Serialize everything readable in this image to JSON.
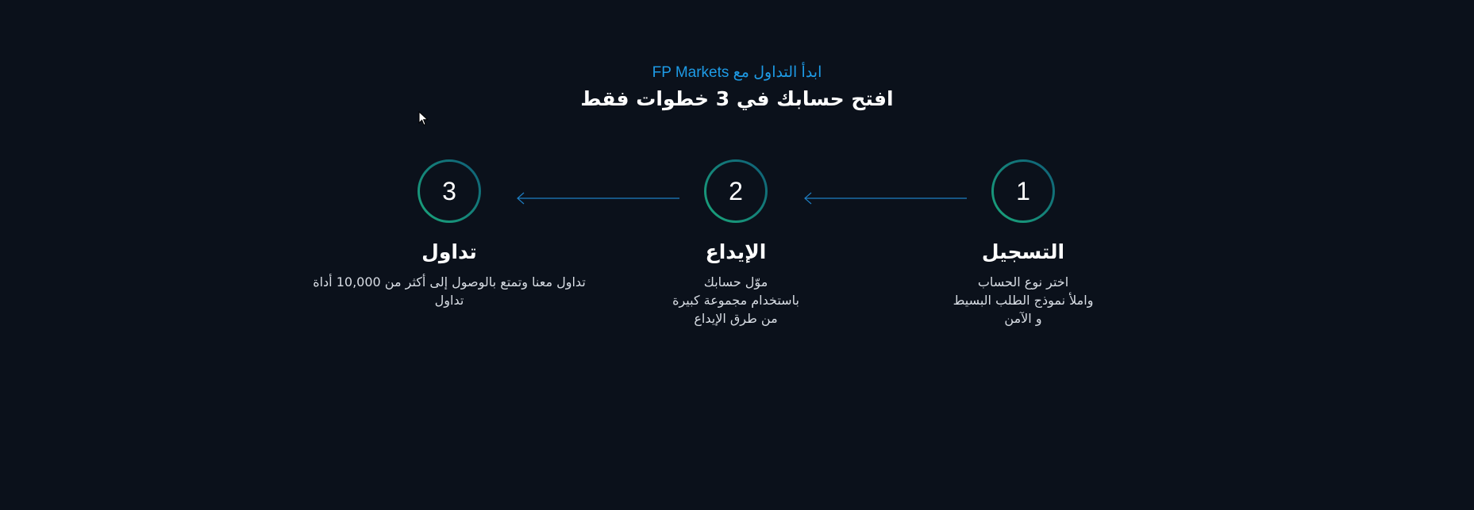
{
  "header": {
    "eyebrow": "ابدأ التداول مع FP Markets",
    "title": "افتح حسابك في 3 خطوات فقط"
  },
  "colors": {
    "background": "#0b111b",
    "accent_blue": "#1e9be6",
    "circle_gradient_start": "#1aa57a",
    "circle_gradient_end": "#0f5e78",
    "arrow": "#1e7fc4"
  },
  "steps": [
    {
      "number": "1",
      "title": "التسجيل",
      "description": "اختر نوع الحساب\nواملأ نموذج الطلب البسيط\nو الآمن"
    },
    {
      "number": "2",
      "title": "الإيداع",
      "description": "موّل حسابك\nباستخدام مجموعة كبيرة\nمن طرق الإيداع"
    },
    {
      "number": "3",
      "title": "تداول",
      "description": "تداول معنا وتمتع بالوصول إلى أكثر من 10,000 أداة\nتداول"
    }
  ],
  "icons": {
    "arrow": "arrow-left-icon",
    "cursor": "mouse-cursor-icon"
  }
}
